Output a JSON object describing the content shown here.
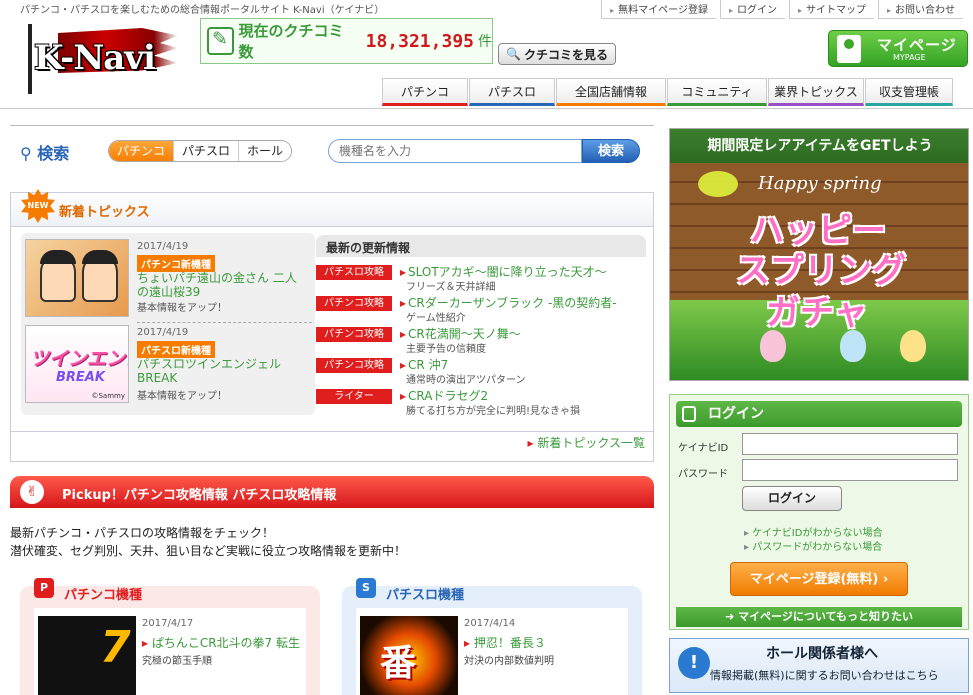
{
  "header": {
    "tagline": "パチンコ・パチスロを楽しむための総合情報ポータルサイト K-Navi（ケイナビ）",
    "top_links": [
      "無料マイページ登録",
      "ログイン",
      "サイトマップ",
      "お問い合わせ"
    ],
    "logo_text": "K-Navi",
    "kuchikomi_label": "現在のクチコミ数",
    "kuchikomi_count": "18,321,395",
    "kuchikomi_unit": "件",
    "kuchikomi_button": "クチコミを見る",
    "mypage_label": "マイページ",
    "mypage_sub": "MYPAGE"
  },
  "nav": [
    {
      "label": "パチンコ",
      "color": "#e01e1e",
      "w": 86
    },
    {
      "label": "パチスロ",
      "color": "#2a66b6",
      "w": 86
    },
    {
      "label": "全国店舗情報",
      "color": "#f57c00",
      "w": 110
    },
    {
      "label": "コミュニティ",
      "color": "#3a9a3a",
      "w": 100
    },
    {
      "label": "業界トピックス",
      "color": "#9b4fc6",
      "w": 96
    },
    {
      "label": "収支管理帳",
      "color": "#2aa5a0",
      "w": 88
    }
  ],
  "search": {
    "title": "検索",
    "tabs": [
      "パチンコ",
      "パチスロ",
      "ホール"
    ],
    "placeholder": "機種名を入力",
    "button": "検索"
  },
  "topics": {
    "badge": "NEW",
    "title": "新着トピックス",
    "items": [
      {
        "date": "2017/4/19",
        "tag": "パチンコ新機種",
        "name": "ちょいパチ遠山の金さん 二人の遠山桜39",
        "sub": "基本情報をアップ！"
      },
      {
        "date": "2017/4/19",
        "tag": "パチスロ新機種",
        "name": "パチスロツインエンジェルBREAK",
        "sub": "基本情報をアップ！",
        "thumb_title": "ツインエンジェル",
        "thumb_sub": "BREAK",
        "thumb_credit": "©Sammy"
      }
    ],
    "updates_title": "最新の更新情報",
    "updates": [
      {
        "tag": "パチスロ攻略",
        "name": "SLOTアカギ～闇に降り立った天才～",
        "desc": "フリーズ＆天井詳細"
      },
      {
        "tag": "パチンコ攻略",
        "name": "CRダーカーザンブラック -黒の契約者-",
        "desc": "ゲーム性紹介"
      },
      {
        "tag": "パチンコ攻略",
        "name": "CR花満開～天ノ舞～",
        "desc": "主要予告の信頼度"
      },
      {
        "tag": "パチンコ攻略",
        "name": "CR 沖7",
        "desc": "通常時の演出アツパターン"
      },
      {
        "tag": "ライター",
        "name": "CRAドラセグ2",
        "desc": "勝てる打ち方が完全に判明!見なきゃ損"
      }
    ],
    "more": "新着トピックス一覧"
  },
  "pickup": {
    "title": "Pickup！パチンコ攻略情報 パチスロ攻略情報",
    "intro_line1": "最新パチンコ・パチスロの攻略情報をチェック！",
    "intro_line2": "潜伏確変、セグ判別、天井、狙い目など実戦に役立つ攻略情報を更新中！",
    "pachinko": {
      "title": "パチンコ機種",
      "date": "2017/4/17",
      "name": "ぱちんこCR北斗の拳7 転生",
      "sub": "究極の節玉手順",
      "thumb_mark": "7"
    },
    "pachislo": {
      "title": "パチスロ機種",
      "date": "2017/4/14",
      "name": "押忍！番長３",
      "sub": "対決の内部数値判明",
      "thumb_mark": "番"
    }
  },
  "banner": {
    "title": "期間限定レアアイテムをGETしよう",
    "script": "Happy spring",
    "line1": "ハッピー",
    "line2": "スプリング",
    "line3": "ガチャ"
  },
  "login": {
    "title": "ログイン",
    "id_label": "ケイナビID",
    "pw_label": "パスワード",
    "button": "ログイン",
    "help1": "ケイナビIDがわからない場合",
    "help2": "パスワードがわからない場合",
    "register": "マイページ登録(無料)",
    "more": "マイページについてもっと知りたい"
  },
  "hall": {
    "title": "ホール関係者様へ",
    "sub": "情報掲載(無料)に関するお問い合わせはこちら"
  }
}
